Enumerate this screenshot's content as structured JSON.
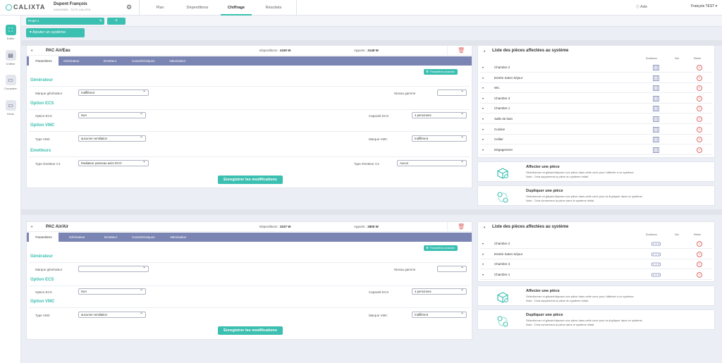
{
  "header": {
    "logo_text": "CALIXTA",
    "user_name": "Dupont François",
    "user_sub": "0A0000985 - TUTO CALIXTA",
    "nav": [
      "Plan",
      "Déperditions",
      "Chiffrage",
      "Résultats"
    ],
    "active_nav": "Chiffrage",
    "help": "Aide",
    "account": "François TEST"
  },
  "sidebar": [
    {
      "label": "Editer",
      "icon": "grid-icon",
      "active": true
    },
    {
      "label": "Chiffrer",
      "icon": "document-icon",
      "active": false
    },
    {
      "label": "Comparer",
      "icon": "inbox-icon",
      "active": false
    },
    {
      "label": "Devis",
      "icon": "tray-icon",
      "active": false
    }
  ],
  "project": {
    "tab_label": "Projet 1",
    "add_label": "+"
  },
  "add_system_label": "Ajouter un système",
  "common": {
    "tabs": [
      "Paramètres",
      "Générateur",
      "Emetteur",
      "Caractéristiques",
      "Valorisation"
    ],
    "param_btn": "Paramètres avancés",
    "sec_generateur": "Générateur",
    "sec_ecs": "Option ECS",
    "sec_vmc": "Option VMC",
    "sec_emetteurs": "Emetteurs",
    "lbl_marque": "Marque générateur",
    "lbl_niveau": "Niveau gamme",
    "lbl_option_ecs": "Option ECS",
    "lbl_capacite": "Capacité ECS",
    "lbl_type_vmc": "Type VMC",
    "lbl_marque_vmc": "Marque VMC",
    "lbl_emetteur_c1": "Type émetteur C1",
    "lbl_emetteur_c2": "Type émetteur C2",
    "save_label": "Enregistrer les modifications",
    "list_title": "Liste des pièces affectées au système",
    "col_emetteurs": "Emetteurs",
    "col_sdc": "Sdc",
    "col_retirer": "Retirer",
    "affect_title": "Affecter une pièce",
    "affect_desc1": "Sélectionner et glisser/déposer une pièce dans cette zone pour l'affecter à ce système.",
    "affect_desc2": "Note : Cela supprimera la pièce du système initial.",
    "dup_title": "Dupliquer une pièce",
    "dup_desc1": "Sélectionner et glisser/déposer une pièce dans cette zone pour la dupliquer dans ce système.",
    "dup_desc2": "Note : Cela conservera la pièce dans le système initial."
  },
  "system1": {
    "name": "PAC Air/Eau",
    "deperditions_label": "Déperditions :",
    "deperditions_value": "4190 W",
    "apports_label": "Apports :",
    "apports_value": "3148 W",
    "marque": "Indifférent",
    "niveau": "",
    "option_ecs": "Non",
    "capacite_ecs": "4 personnes",
    "type_vmc": "aucunne ventilation",
    "marque_vmc": "Indifférent",
    "emetteur_c1": "Radiateur panneau acier ECO",
    "emetteur_c2": "Aucun",
    "rooms": [
      "Chambre 2",
      "Entrée Salon Séjour",
      "WC",
      "Chambre 3",
      "Chambre 1",
      "Salle de bain",
      "Cuisine",
      "Cellier",
      "Dégagement"
    ]
  },
  "system2": {
    "name": "PAC Air/Air",
    "deperditions_label": "Déperditions :",
    "deperditions_value": "3237 W",
    "apports_label": "Apports :",
    "apports_value": "2805 W",
    "marque": "",
    "niveau": "",
    "option_ecs": "Non",
    "capacite_ecs": "4 personnes",
    "type_vmc": "aucunne ventilation",
    "marque_vmc": "Indifférent",
    "rooms": [
      "Chambre 2",
      "Entrée Salon Séjour",
      "Chambre 3",
      "Chambre 1"
    ]
  },
  "colors": {
    "accent": "#3bbfb0",
    "tab_bar": "#7b85b3",
    "danger": "#e06a6a"
  }
}
